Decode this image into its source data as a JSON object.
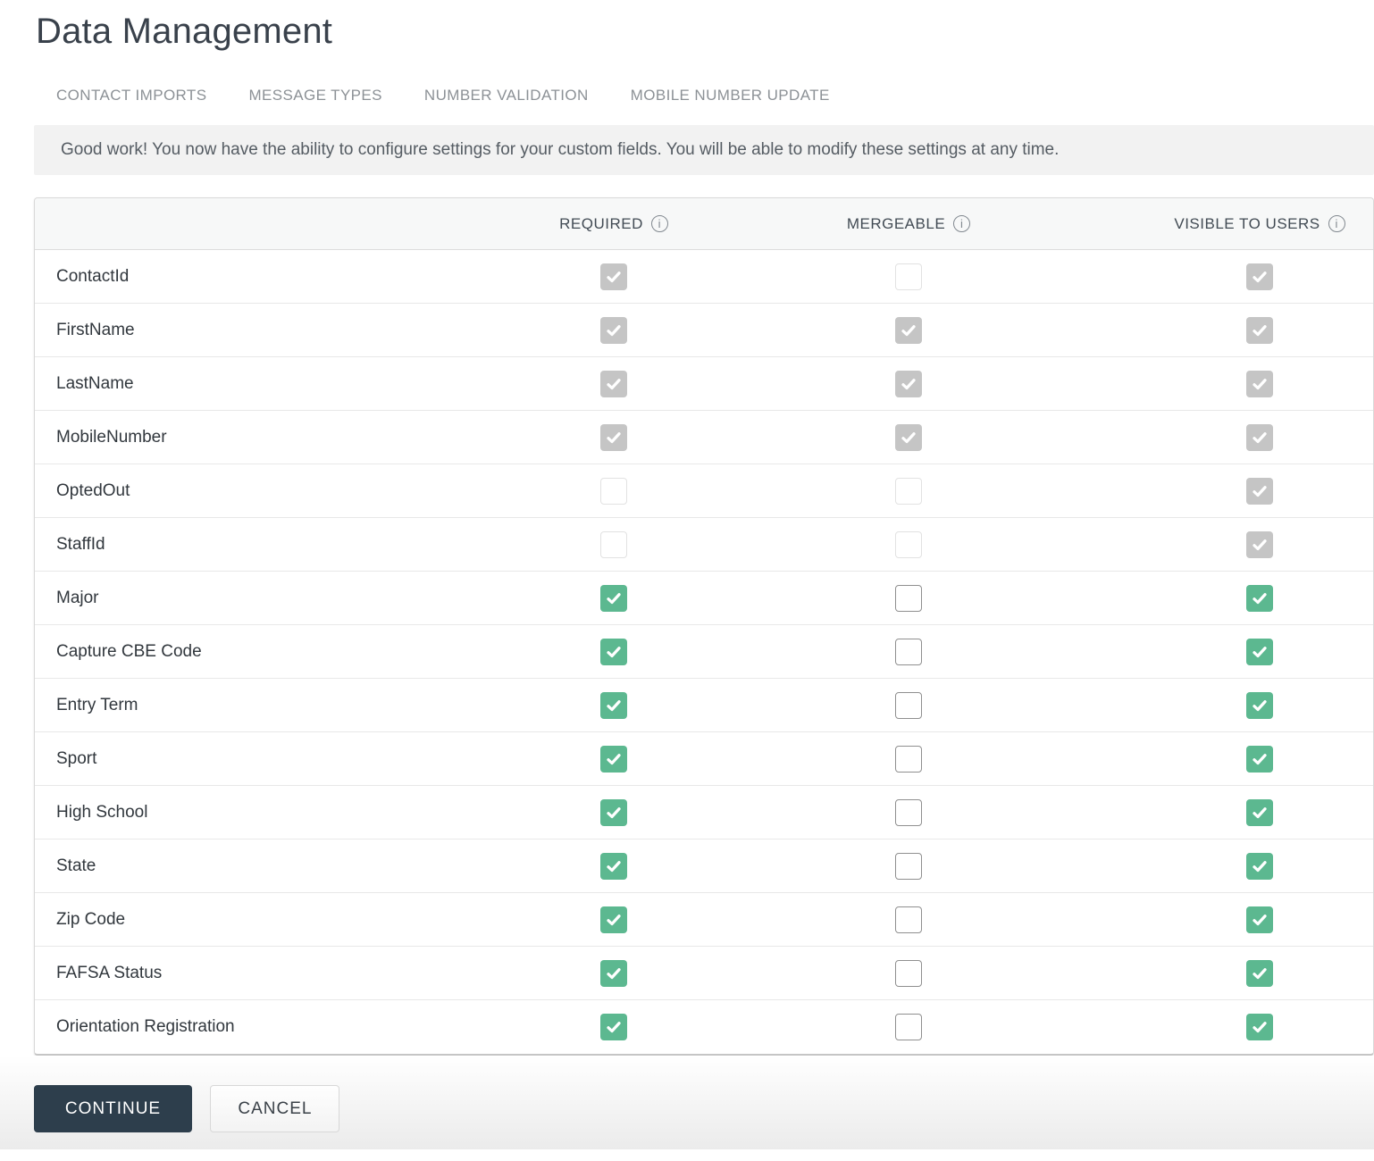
{
  "page": {
    "title": "Data Management"
  },
  "tabs": [
    {
      "label": "CONTACT IMPORTS"
    },
    {
      "label": "MESSAGE TYPES"
    },
    {
      "label": "NUMBER VALIDATION"
    },
    {
      "label": "MOBILE NUMBER UPDATE"
    }
  ],
  "banner": {
    "text": "Good work! You now have the ability to configure settings for your custom fields. You will be able to modify these settings at any time."
  },
  "table": {
    "columns": [
      {
        "key": "required",
        "label": "REQUIRED",
        "info_icon": "info-icon"
      },
      {
        "key": "mergeable",
        "label": "MERGEABLE",
        "info_icon": "info-icon"
      },
      {
        "key": "visible",
        "label": "VISIBLE TO USERS",
        "info_icon": "info-icon"
      }
    ],
    "rows": [
      {
        "label": "ContactId",
        "required": {
          "checked": true,
          "disabled": true
        },
        "mergeable": {
          "checked": false,
          "disabled": true
        },
        "visible": {
          "checked": true,
          "disabled": true
        }
      },
      {
        "label": "FirstName",
        "required": {
          "checked": true,
          "disabled": true
        },
        "mergeable": {
          "checked": true,
          "disabled": true
        },
        "visible": {
          "checked": true,
          "disabled": true
        }
      },
      {
        "label": "LastName",
        "required": {
          "checked": true,
          "disabled": true
        },
        "mergeable": {
          "checked": true,
          "disabled": true
        },
        "visible": {
          "checked": true,
          "disabled": true
        }
      },
      {
        "label": "MobileNumber",
        "required": {
          "checked": true,
          "disabled": true
        },
        "mergeable": {
          "checked": true,
          "disabled": true
        },
        "visible": {
          "checked": true,
          "disabled": true
        }
      },
      {
        "label": "OptedOut",
        "required": {
          "checked": false,
          "disabled": true
        },
        "mergeable": {
          "checked": false,
          "disabled": true
        },
        "visible": {
          "checked": true,
          "disabled": true
        }
      },
      {
        "label": "StaffId",
        "required": {
          "checked": false,
          "disabled": true
        },
        "mergeable": {
          "checked": false,
          "disabled": true
        },
        "visible": {
          "checked": true,
          "disabled": true
        }
      },
      {
        "label": "Major",
        "required": {
          "checked": true,
          "disabled": false
        },
        "mergeable": {
          "checked": false,
          "disabled": false
        },
        "visible": {
          "checked": true,
          "disabled": false
        }
      },
      {
        "label": "Capture CBE Code",
        "required": {
          "checked": true,
          "disabled": false
        },
        "mergeable": {
          "checked": false,
          "disabled": false
        },
        "visible": {
          "checked": true,
          "disabled": false
        }
      },
      {
        "label": "Entry Term",
        "required": {
          "checked": true,
          "disabled": false
        },
        "mergeable": {
          "checked": false,
          "disabled": false
        },
        "visible": {
          "checked": true,
          "disabled": false
        }
      },
      {
        "label": "Sport",
        "required": {
          "checked": true,
          "disabled": false
        },
        "mergeable": {
          "checked": false,
          "disabled": false
        },
        "visible": {
          "checked": true,
          "disabled": false
        }
      },
      {
        "label": "High School",
        "required": {
          "checked": true,
          "disabled": false
        },
        "mergeable": {
          "checked": false,
          "disabled": false
        },
        "visible": {
          "checked": true,
          "disabled": false
        }
      },
      {
        "label": "State",
        "required": {
          "checked": true,
          "disabled": false
        },
        "mergeable": {
          "checked": false,
          "disabled": false
        },
        "visible": {
          "checked": true,
          "disabled": false
        }
      },
      {
        "label": "Zip Code",
        "required": {
          "checked": true,
          "disabled": false
        },
        "mergeable": {
          "checked": false,
          "disabled": false
        },
        "visible": {
          "checked": true,
          "disabled": false
        }
      },
      {
        "label": "FAFSA Status",
        "required": {
          "checked": true,
          "disabled": false
        },
        "mergeable": {
          "checked": false,
          "disabled": false
        },
        "visible": {
          "checked": true,
          "disabled": false
        }
      },
      {
        "label": "Orientation Registration",
        "required": {
          "checked": true,
          "disabled": false
        },
        "mergeable": {
          "checked": false,
          "disabled": false
        },
        "visible": {
          "checked": true,
          "disabled": false
        }
      }
    ]
  },
  "actions": {
    "continue_label": "CONTINUE",
    "cancel_label": "CANCEL"
  },
  "colors": {
    "checkbox_checked_green": "#5cb890",
    "checkbox_checked_disabled_gray": "#c5c5c5",
    "continue_button_bg": "#2d3e4c",
    "banner_bg": "#f2f2f2",
    "header_row_bg": "#f7f8f8"
  }
}
